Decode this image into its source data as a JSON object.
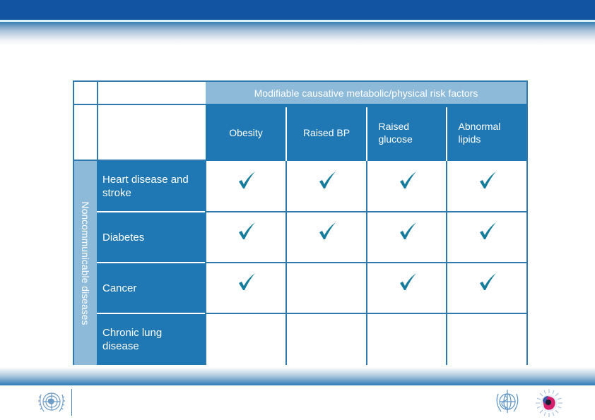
{
  "header_band": {
    "color": "#1253a2"
  },
  "table": {
    "group_header": "Modifiable causative metabolic/physical risk factors",
    "side_label": "Noncommunicable diseases",
    "columns": [
      "Obesity",
      "Raised BP",
      "Raised glucose",
      "Abnormal lipids"
    ],
    "columns_lines": [
      [
        "Obesity"
      ],
      [
        "Raised BP"
      ],
      [
        "Raised",
        "glucose"
      ],
      [
        "Abnormal",
        "lipids"
      ]
    ],
    "rows": [
      {
        "label": "Heart disease and stroke",
        "label_lines": [
          "Heart disease and",
          "stroke"
        ],
        "checks": [
          true,
          true,
          true,
          true
        ]
      },
      {
        "label": "Diabetes",
        "label_lines": [
          "Diabetes"
        ],
        "checks": [
          true,
          true,
          true,
          true
        ]
      },
      {
        "label": "Cancer",
        "label_lines": [
          "Cancer"
        ],
        "checks": [
          true,
          false,
          true,
          true
        ]
      },
      {
        "label": "Chronic lung disease",
        "label_lines": [
          "Chronic lung",
          "disease"
        ],
        "checks": [
          false,
          false,
          false,
          false
        ]
      }
    ],
    "colors": {
      "header_dark": "#1f78b4",
      "header_light": "#8dbad9",
      "grid": "#2e7aaf",
      "check": "#157d9b"
    }
  },
  "footer": {
    "logos": [
      {
        "name": "un-emblem-logo"
      },
      {
        "name": "who-emblem-logo"
      },
      {
        "name": "iarc-logo"
      }
    ]
  }
}
